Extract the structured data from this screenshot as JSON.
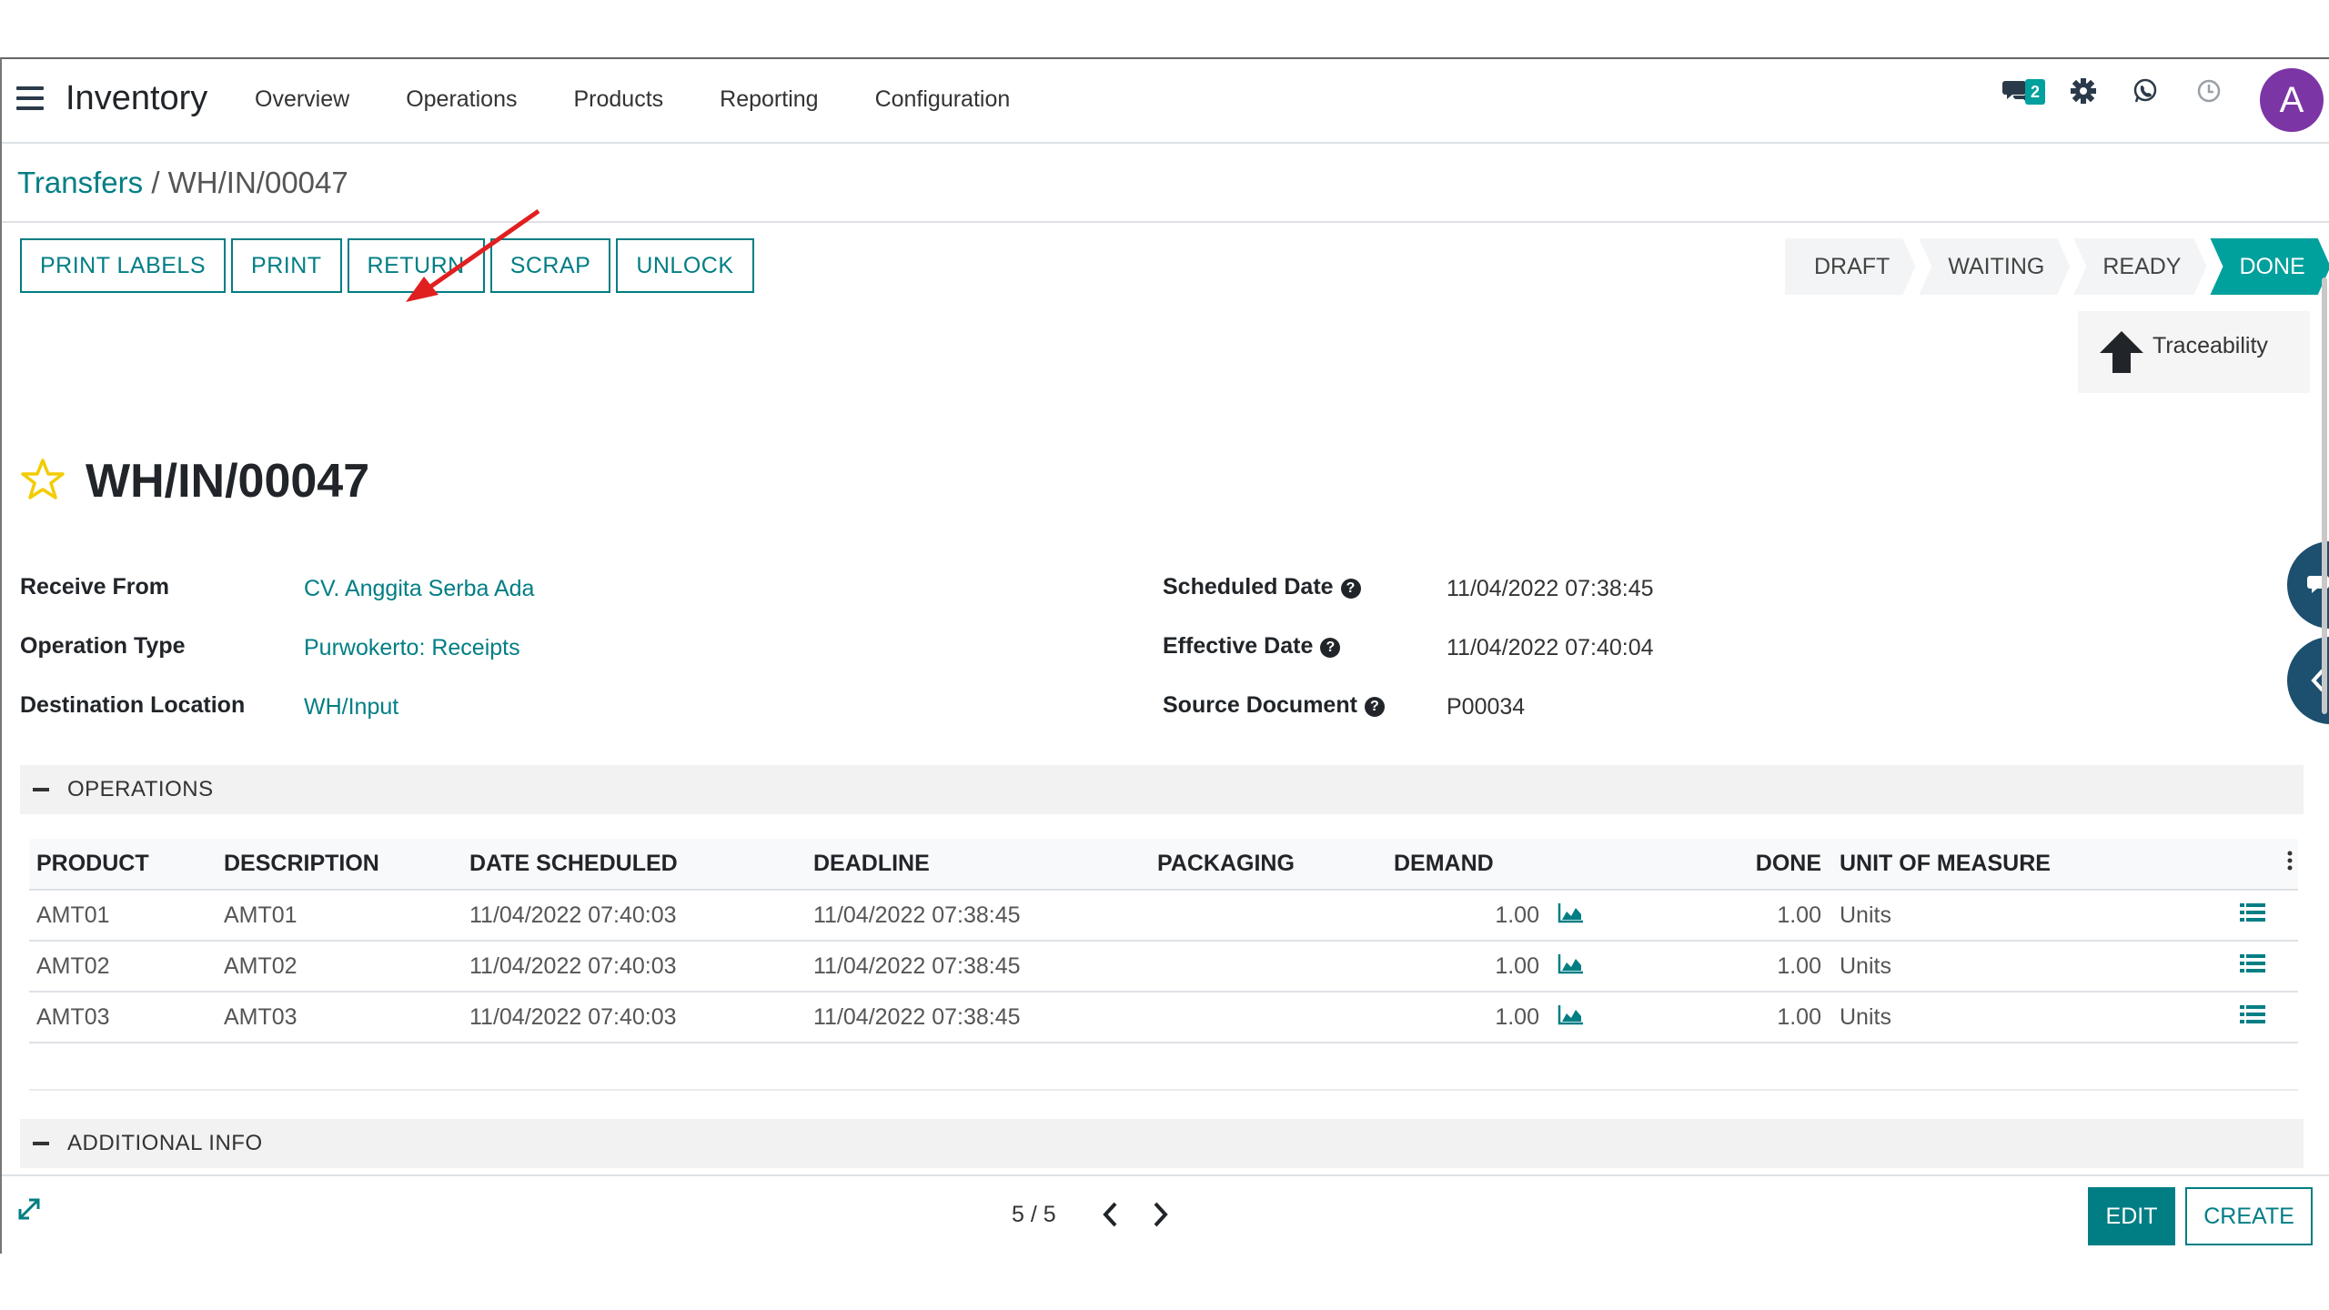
{
  "navbar": {
    "app_name": "Inventory",
    "menu": [
      "Overview",
      "Operations",
      "Products",
      "Reporting",
      "Configuration"
    ],
    "message_count": "2",
    "avatar_initial": "A",
    "avatar_color": "#7c35a5"
  },
  "breadcrumb": {
    "parent": "Transfers",
    "separator": "/",
    "current": "WH/IN/00047"
  },
  "actions": {
    "print_labels": "PRINT LABELS",
    "print": "PRINT",
    "return": "RETURN",
    "scrap": "SCRAP",
    "unlock": "UNLOCK"
  },
  "statusbar": {
    "states": [
      "DRAFT",
      "WAITING",
      "READY",
      "DONE"
    ],
    "active": "DONE"
  },
  "smart_buttons": {
    "traceability": "Traceability"
  },
  "record": {
    "title": "WH/IN/00047",
    "favorite": false
  },
  "fields_left": [
    {
      "label": "Receive From",
      "value": "CV. Anggita Serba Ada"
    },
    {
      "label": "Operation Type",
      "value": "Purwokerto: Receipts"
    },
    {
      "label": "Destination Location",
      "value": "WH/Input"
    }
  ],
  "fields_right": [
    {
      "label": "Scheduled Date",
      "value": "11/04/2022 07:38:45"
    },
    {
      "label": "Effective Date",
      "value": "11/04/2022 07:40:04"
    },
    {
      "label": "Source Document",
      "value": "P00034"
    }
  ],
  "operations": {
    "section_title": "OPERATIONS",
    "columns": [
      "PRODUCT",
      "DESCRIPTION",
      "DATE SCHEDULED",
      "DEADLINE",
      "PACKAGING",
      "DEMAND",
      "DONE",
      "UNIT OF MEASURE"
    ],
    "rows": [
      {
        "product": "AMT01",
        "description": "AMT01",
        "date_scheduled": "11/04/2022 07:40:03",
        "deadline": "11/04/2022 07:38:45",
        "packaging": "",
        "demand": "1.00",
        "done": "1.00",
        "uom": "Units"
      },
      {
        "product": "AMT02",
        "description": "AMT02",
        "date_scheduled": "11/04/2022 07:40:03",
        "deadline": "11/04/2022 07:38:45",
        "packaging": "",
        "demand": "1.00",
        "done": "1.00",
        "uom": "Units"
      },
      {
        "product": "AMT03",
        "description": "AMT03",
        "date_scheduled": "11/04/2022 07:40:03",
        "deadline": "11/04/2022 07:38:45",
        "packaging": "",
        "demand": "1.00",
        "done": "1.00",
        "uom": "Units"
      }
    ]
  },
  "additional_info": {
    "section_title": "ADDITIONAL INFO"
  },
  "pager": {
    "value": "5 / 5"
  },
  "footer_buttons": {
    "edit": "EDIT",
    "create": "CREATE"
  },
  "colors": {
    "accent": "#017e84",
    "status_active": "#00a09d",
    "side_tab": "#1d4f6e",
    "annotation_arrow": "#e02020"
  }
}
